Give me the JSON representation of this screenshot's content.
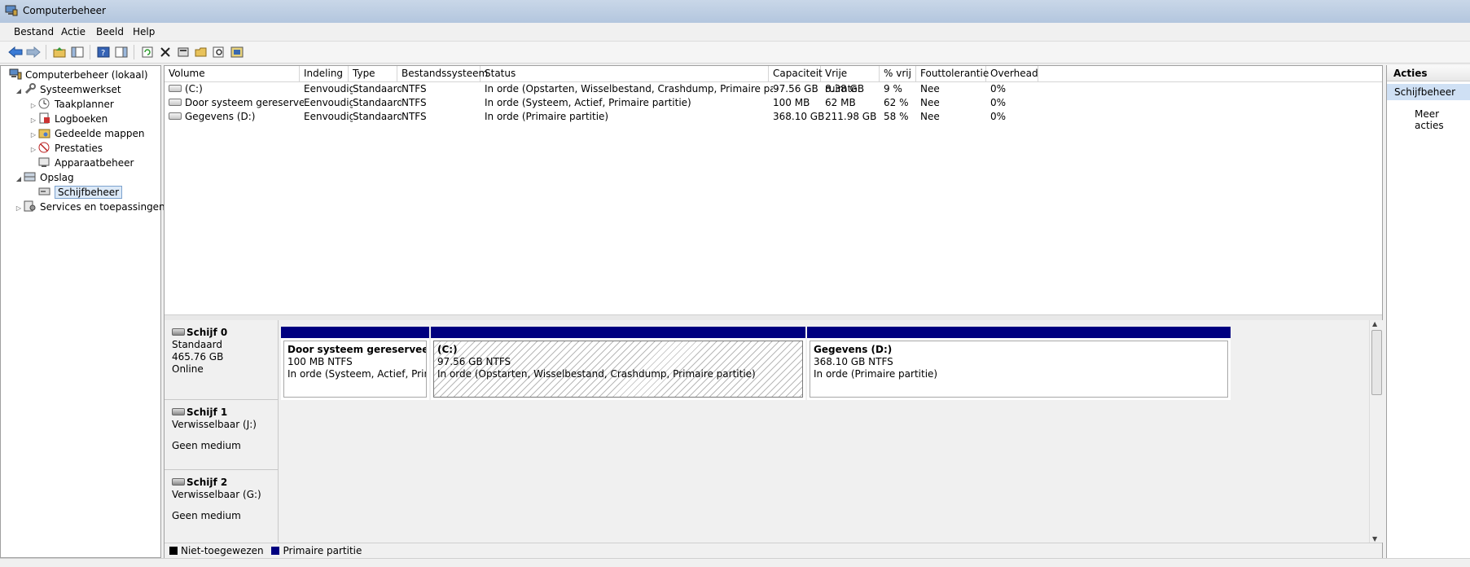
{
  "window": {
    "title": "Computerbeheer"
  },
  "menu": [
    "Bestand",
    "Actie",
    "Beeld",
    "Help"
  ],
  "tree": {
    "root": "Computerbeheer (lokaal)",
    "systeemwerkset": "Systeemwerkset",
    "taakplanner": "Taakplanner",
    "logboeken": "Logboeken",
    "gedeelde_mappen": "Gedeelde mappen",
    "prestaties": "Prestaties",
    "apparaatbeheer": "Apparaatbeheer",
    "opslag": "Opslag",
    "schijfbeheer": "Schijfbeheer",
    "services": "Services en toepassingen"
  },
  "volumes": {
    "columns": [
      "Volume",
      "Indeling",
      "Type",
      "Bestandssysteem",
      "Status",
      "Capaciteit",
      "Vrije ruimte",
      "% vrij",
      "Fouttolerantie",
      "Overhead"
    ],
    "rows": [
      [
        "(C:)",
        "Eenvoudig",
        "Standaard",
        "NTFS",
        "In orde (Opstarten, Wisselbestand, Crashdump, Primaire partitie)",
        "97.56 GB",
        "8.38 GB",
        "9 %",
        "Nee",
        "0%"
      ],
      [
        "Door systeem gereserveerd",
        "Eenvoudig",
        "Standaard",
        "NTFS",
        "In orde (Systeem, Actief, Primaire partitie)",
        "100 MB",
        "62 MB",
        "62 %",
        "Nee",
        "0%"
      ],
      [
        "Gegevens (D:)",
        "Eenvoudig",
        "Standaard",
        "NTFS",
        "In orde (Primaire partitie)",
        "368.10 GB",
        "211.98 GB",
        "58 %",
        "Nee",
        "0%"
      ]
    ]
  },
  "disks": {
    "disk0": {
      "name": "Schijf 0",
      "type": "Standaard",
      "size": "465.76 GB",
      "state": "Online",
      "partitions": [
        {
          "name": "Door systeem gereserveerd",
          "size": "100 MB NTFS",
          "status": "In orde (Systeem, Actief, Primaire partitie)"
        },
        {
          "name": "(C:)",
          "size": "97.56 GB NTFS",
          "status": "In orde (Opstarten, Wisselbestand, Crashdump, Primaire partitie)"
        },
        {
          "name": "Gegevens  (D:)",
          "size": "368.10 GB NTFS",
          "status": "In orde (Primaire partitie)"
        }
      ]
    },
    "disk1": {
      "name": "Schijf 1",
      "type": "Verwisselbaar (J:)",
      "state": "Geen medium"
    },
    "disk2": {
      "name": "Schijf 2",
      "type": "Verwisselbaar (G:)",
      "state": "Geen medium"
    }
  },
  "legend": {
    "unallocated": "Niet-toegewezen",
    "primary": "Primaire partitie",
    "unallocated_color": "#000000",
    "primary_color": "#000080"
  },
  "actions": {
    "header": "Acties",
    "section": "Schijfbeheer",
    "more": "Meer acties"
  }
}
